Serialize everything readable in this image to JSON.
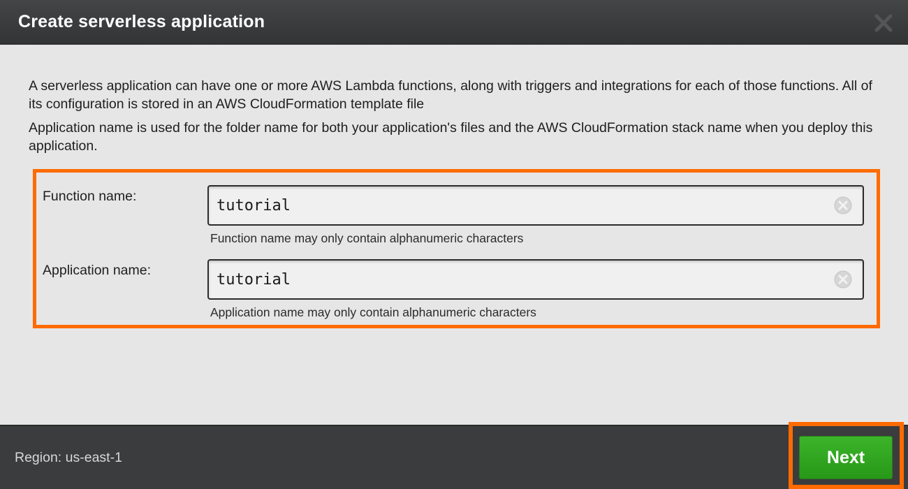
{
  "dialog": {
    "title": "Create serverless application"
  },
  "description": {
    "paragraph1": "A serverless application can have one or more AWS Lambda functions, along with triggers and integrations for each of those functions. All of its configuration is stored in an AWS CloudFormation template file",
    "paragraph2": "Application name is used for the folder name for both your application's files and the AWS CloudFormation stack name when you deploy this application."
  },
  "form": {
    "function_name": {
      "label": "Function name:",
      "value": "tutorial",
      "hint": "Function name may only contain alphanumeric characters"
    },
    "application_name": {
      "label": "Application name:",
      "value": "tutorial",
      "hint": "Application name may only contain alphanumeric characters"
    }
  },
  "footer": {
    "region": "Region: us-east-1",
    "next_label": "Next"
  },
  "colors": {
    "highlight": "#ff6b00",
    "primary_button": "#2e9f1e",
    "titlebar": "#3a3b3c"
  },
  "icons": {
    "close": "close-icon",
    "clear": "clear-input-icon"
  }
}
